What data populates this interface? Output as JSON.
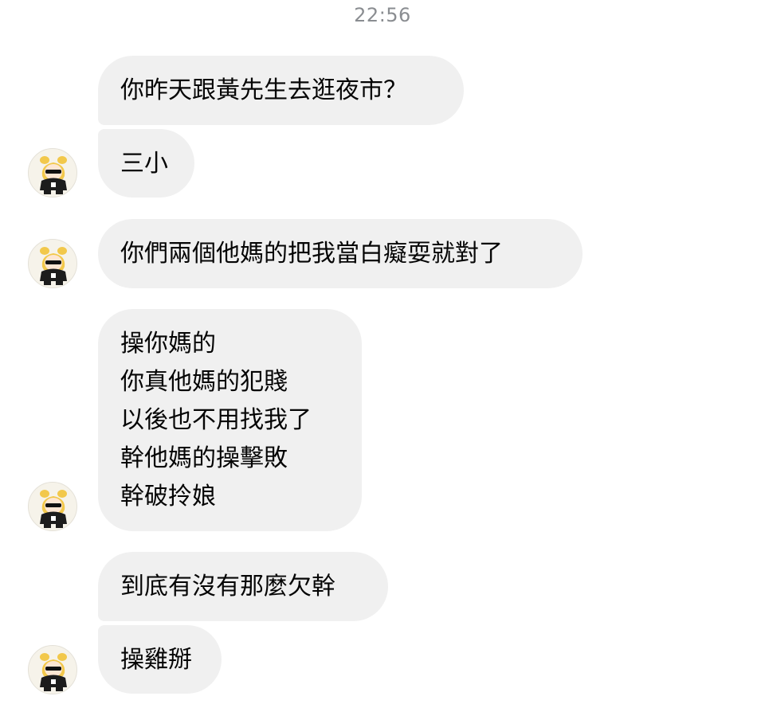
{
  "timestamp": "22:56",
  "messages": [
    {
      "lines": [
        "你昨天跟黃先生去逛夜市？"
      ]
    },
    {
      "lines": [
        "三小"
      ]
    },
    {
      "lines": [
        "你們兩個他媽的把我當白癡耍就對了"
      ]
    },
    {
      "lines": [
        "操你媽的",
        "你真他媽的犯賤",
        "以後也不用找我了",
        "幹他媽的操擊敗",
        "幹破拎娘"
      ]
    },
    {
      "lines": [
        "到底有沒有那麼欠幹"
      ]
    },
    {
      "lines": [
        "操雞掰"
      ]
    }
  ],
  "avatar": {
    "icon": "sender-avatar-sunglasses-character"
  }
}
